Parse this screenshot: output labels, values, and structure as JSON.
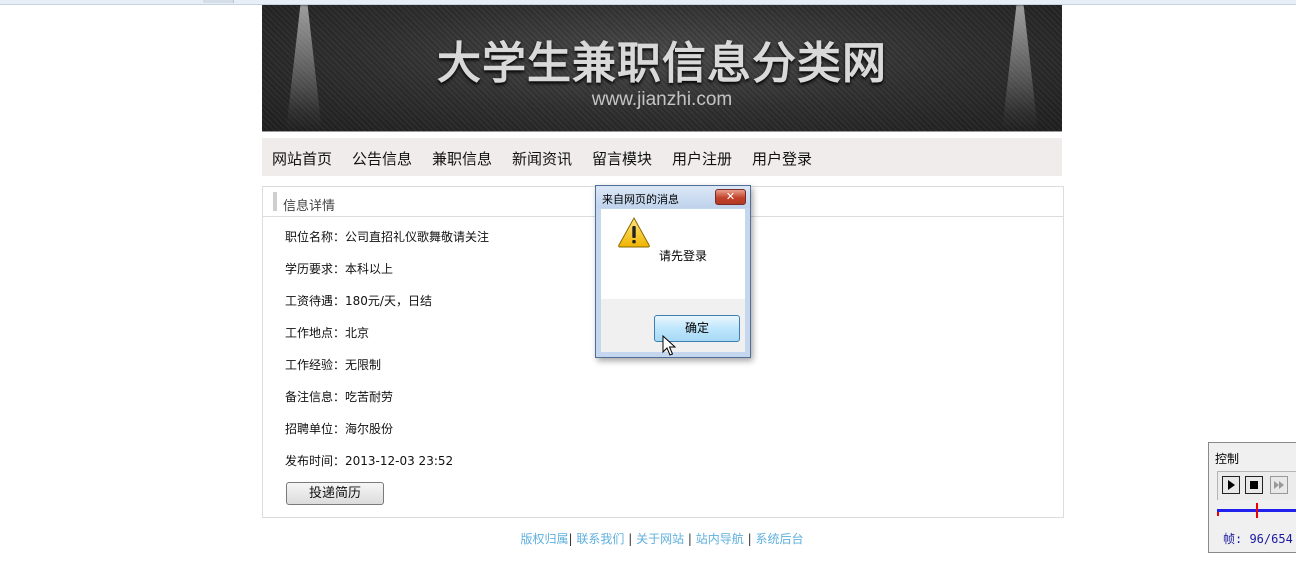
{
  "banner": {
    "title": "大学生兼职信息分类网",
    "url": "www.jianzhi.com"
  },
  "nav": {
    "items": [
      "网站首页",
      "公告信息",
      "兼职信息",
      "新闻资讯",
      "留言模块",
      "用户注册",
      "用户登录"
    ]
  },
  "panel": {
    "title": "信息详情",
    "rows": [
      "职位名称：公司直招礼仪歌舞敬请关注",
      "学历要求：本科以上",
      "工资待遇：180元/天，日结",
      "工作地点：北京",
      "工作经验：无限制",
      "备注信息：吃苦耐劳",
      "招聘单位：海尔股份",
      "发布时间：2013-12-03 23:52"
    ],
    "submit_label": "投递简历"
  },
  "footer": {
    "links": [
      "版权归属",
      "联系我们",
      "关于网站",
      "站内导航",
      "系统后台"
    ],
    "separator": "|"
  },
  "dialog": {
    "title": "来自网页的消息",
    "close_glyph": "✕",
    "message": "请先登录",
    "ok_label": "确定"
  },
  "control": {
    "title": "控制",
    "frame_label": "帧: 96/654",
    "frame_current": 96,
    "frame_total": 654
  },
  "colors": {
    "link": "#5fb0df",
    "nav_bg": "#efeceb",
    "dialog_frame": "#c5d7ee",
    "track": "#2222ee",
    "marker": "#ee0000"
  },
  "icons": [
    "warning-icon",
    "close-icon",
    "play-icon",
    "stop-icon",
    "fast-forward-icon",
    "mouse-cursor-icon"
  ]
}
